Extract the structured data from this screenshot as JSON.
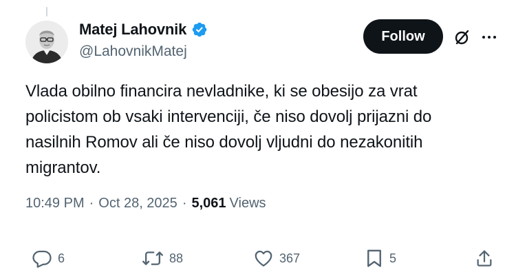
{
  "author": {
    "name": "Matej Lahovnik",
    "handle": "@LahovnikMatej",
    "verified": true,
    "verified_color": "#1d9bf0"
  },
  "follow_button_label": "Follow",
  "icons": {
    "avatar": "avatar-photo",
    "verified": "verified-badge-icon",
    "grok": "grok-icon",
    "more": "more-icon",
    "reply": "reply-icon",
    "retweet": "retweet-icon",
    "like": "like-icon",
    "bookmark": "bookmark-icon",
    "share": "share-icon"
  },
  "tweet": {
    "text_lines": [
      "Vlada obilno financira nevladnike, ki se obesijo za vrat",
      "policistom ob vsaki intervenciji, če niso dovolj prijazni do",
      "nasilnih Romov ali če niso dovolj vljudni do nezakonitih",
      "migrantov."
    ],
    "time": "10:49 PM",
    "separator": "·",
    "date": "Oct 28, 2025",
    "views_count": "5,061",
    "views_label": "Views"
  },
  "actions": {
    "replies": "6",
    "reposts": "88",
    "likes": "367",
    "bookmarks": "5"
  }
}
